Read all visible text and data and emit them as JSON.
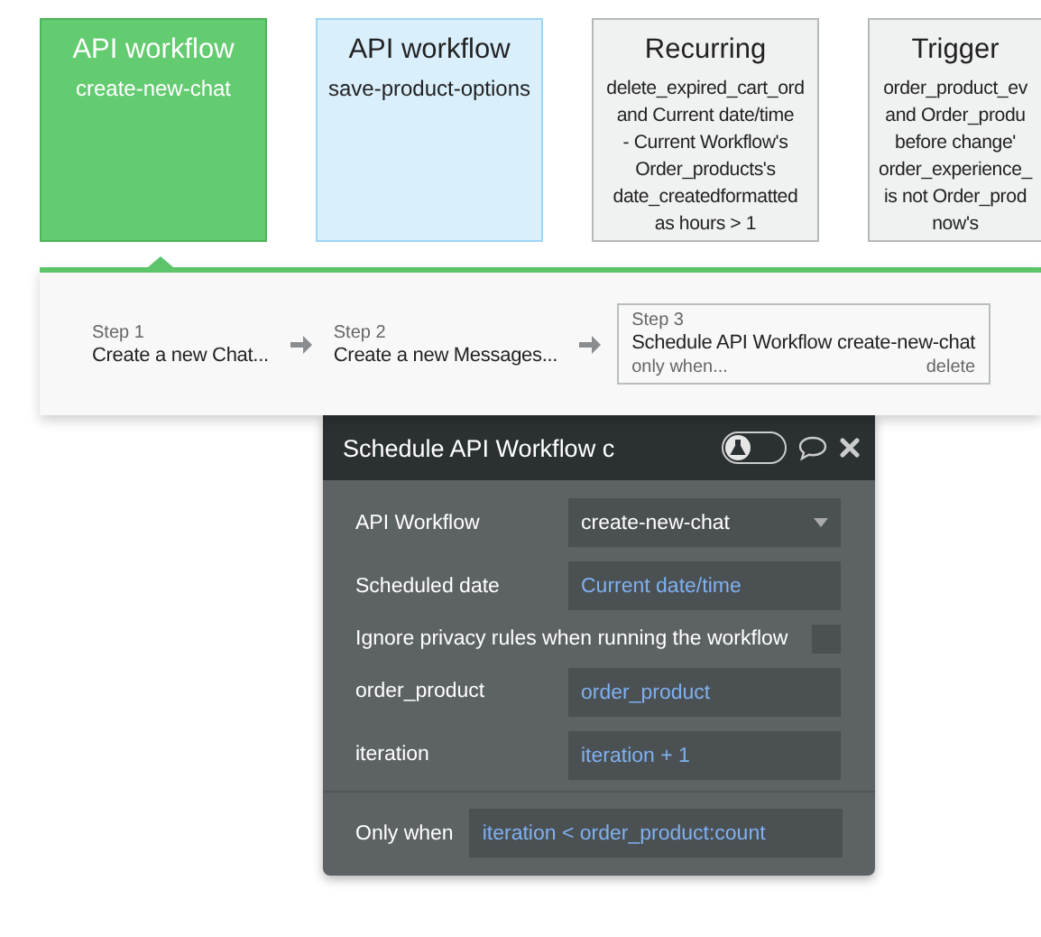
{
  "workflow_cards": [
    {
      "kind": "api",
      "title": "API workflow",
      "subtitle": "create-new-chat",
      "selected": true
    },
    {
      "kind": "api",
      "title": "API workflow",
      "subtitle": "save-product-options",
      "selected": false
    },
    {
      "kind": "recurring",
      "title": "Recurring",
      "lines": [
        "delete_expired_cart_ord",
        "and Current date/time",
        "- Current Workflow's",
        "Order_products's",
        "date_createdformatted",
        "as hours > 1"
      ],
      "selected": false
    },
    {
      "kind": "trigger",
      "title": "Trigger",
      "lines": [
        "order_product_ev",
        "and Order_produ",
        "before change'",
        "order_experience_",
        "is not Order_prod",
        "now's"
      ],
      "selected": false
    }
  ],
  "steps": [
    {
      "label": "Step 1",
      "title": "Create a new Chat...",
      "selected": false
    },
    {
      "label": "Step 2",
      "title": "Create a new Messages...",
      "selected": false
    },
    {
      "label": "Step 3",
      "title": "Schedule API Workflow create-new-chat",
      "condition": "only when...",
      "action": "delete",
      "selected": true
    }
  ],
  "action_panel": {
    "title": "Schedule API Workflow c",
    "debug_toggle_on": false,
    "fields": [
      {
        "kind": "dropdown",
        "label": "API Workflow",
        "value": "create-new-chat"
      },
      {
        "kind": "expression",
        "label": "Scheduled date",
        "value": "Current date/time"
      },
      {
        "kind": "checkbox",
        "label": "Ignore privacy rules when running the workflow",
        "checked": false
      },
      {
        "kind": "expression",
        "label": "order_product",
        "value": "order_product"
      },
      {
        "kind": "expression",
        "label": "iteration",
        "value": "iteration + 1"
      }
    ],
    "only_when": {
      "label": "Only when",
      "value": "iteration < order_product:count"
    }
  }
}
